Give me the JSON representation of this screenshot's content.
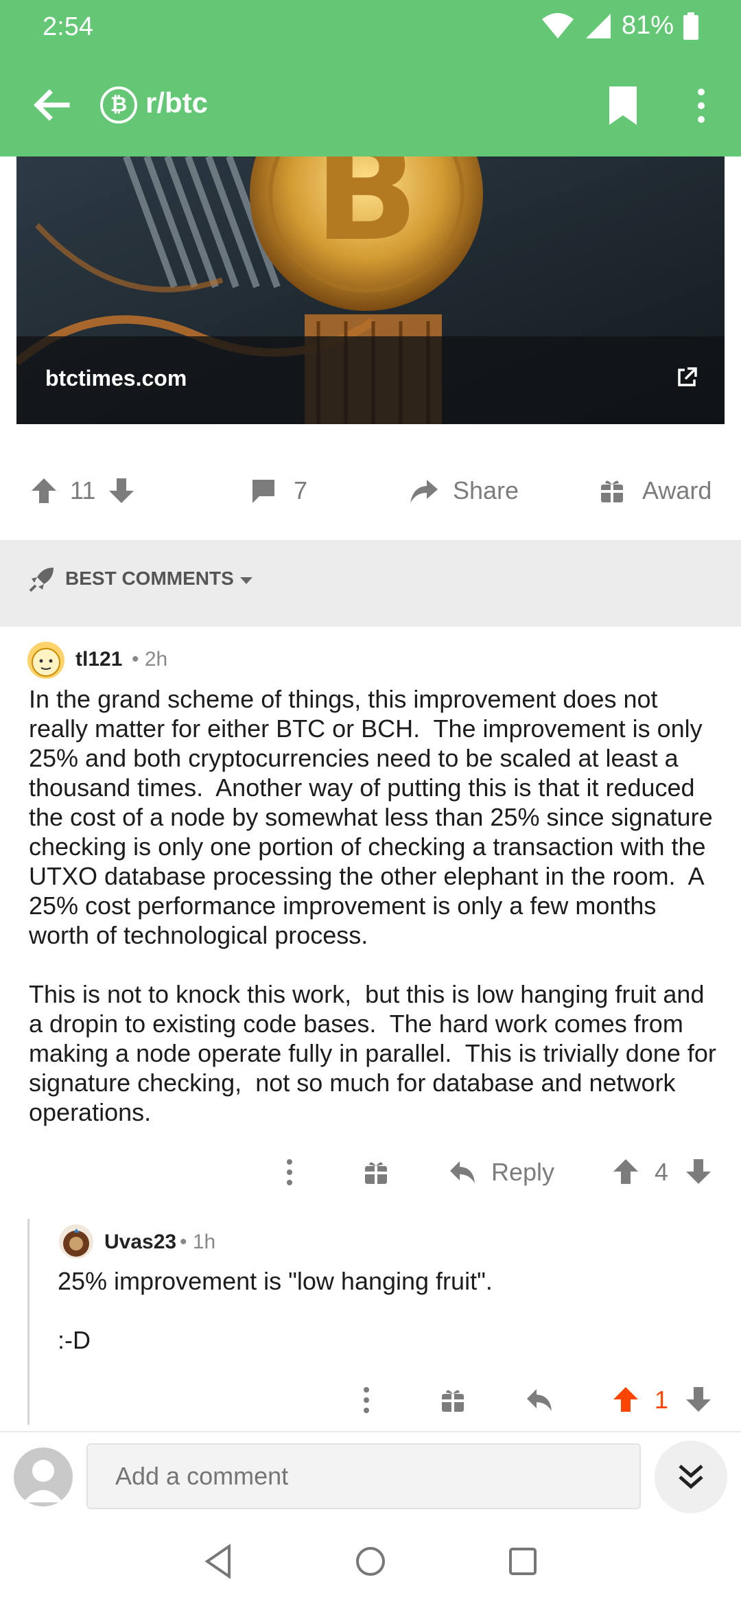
{
  "status_bar": {
    "time": "2:54",
    "battery": "81%"
  },
  "header": {
    "subreddit": "r/btc",
    "sub_icon": "bitcoin-icon"
  },
  "link": {
    "domain": "btctimes.com"
  },
  "post_actions": {
    "score": "11",
    "comments": "7",
    "share_label": "Share",
    "award_label": "Award"
  },
  "sort": {
    "label": "BEST COMMENTS"
  },
  "comments": [
    {
      "user": "tl121",
      "age": "• 2h",
      "body": "In the grand scheme of things, this improvement does not really matter for either BTC or BCH.  The improvement is only 25% and both cryptocurrencies need to be scaled at least a thousand times.  Another way of putting this is that it reduced the cost of a node by somewhat less than 25% since signature checking is only one portion of checking a transaction with the UTXO database processing the other elephant in the room.  A 25% cost performance improvement is only a few months worth of technological process.\n\nThis is not to knock this work,  but this is low hanging fruit and a dropin to existing code bases.  The hard work comes from making a node operate fully in parallel.  This is trivially done for signature checking,  not so much for database and network operations.",
      "reply_label": "Reply",
      "score": "4"
    },
    {
      "user": "Uvas23",
      "age": "• 1h",
      "body": "25% improvement is \"low hanging fruit\".\n\n:-D",
      "score": "1",
      "upvoted": true
    }
  ],
  "composer": {
    "placeholder": "Add a comment"
  },
  "colors": {
    "brand_green": "#63c775",
    "upvote_orange": "#ff4500",
    "gray_icon": "#7c7c7c"
  }
}
